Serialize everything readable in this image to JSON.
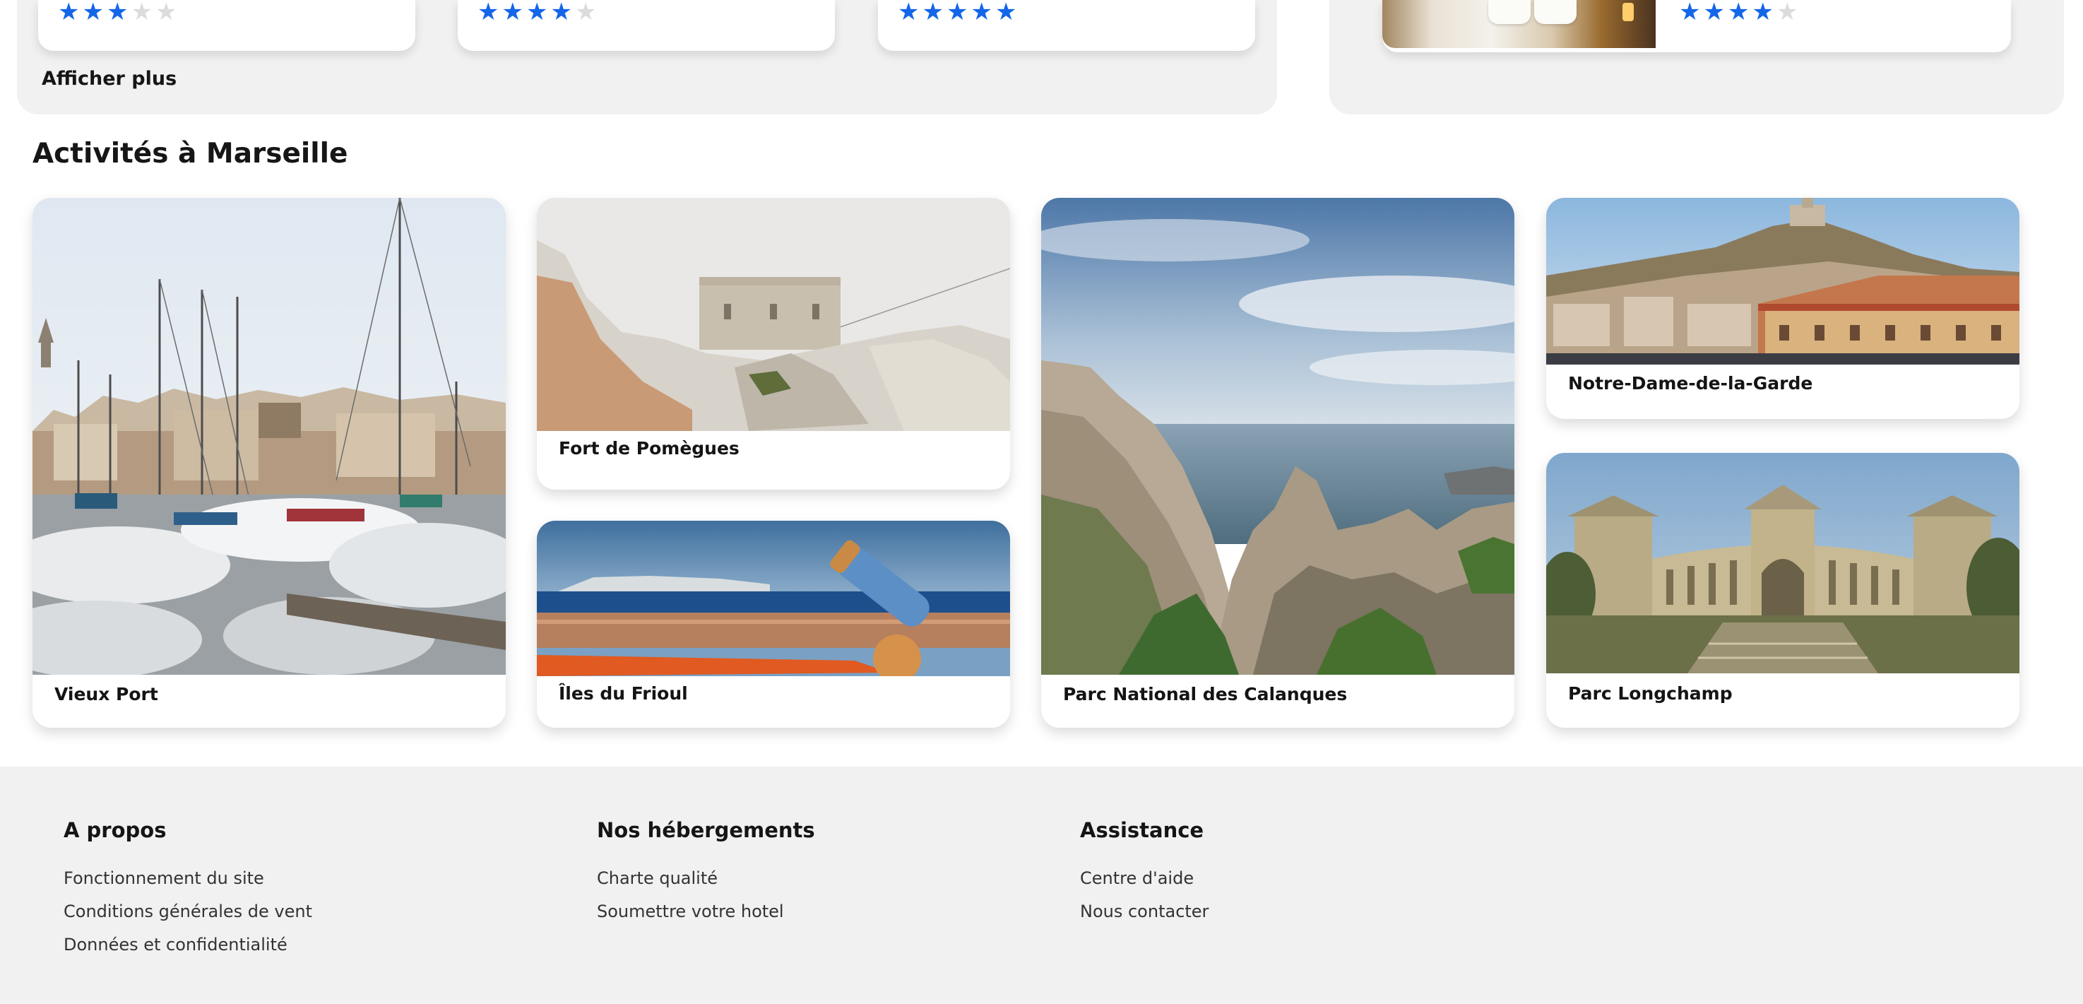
{
  "top": {
    "show_more_label": "Afficher plus",
    "rating_cards": [
      {
        "rating": 3,
        "max": 5
      },
      {
        "rating": 4,
        "max": 5
      },
      {
        "rating": 5,
        "max": 5
      }
    ],
    "hotel_card": {
      "rating": 4,
      "max": 5
    }
  },
  "activities": {
    "title": "Activités à Marseille",
    "items": [
      {
        "name": "Vieux Port"
      },
      {
        "name": "Fort de Pomègues"
      },
      {
        "name": "Îles du Frioul"
      },
      {
        "name": "Parc National des Calanques"
      },
      {
        "name": "Notre-Dame-de-la-Garde"
      },
      {
        "name": "Parc Longchamp"
      }
    ]
  },
  "footer": {
    "about": {
      "title": "A propos",
      "links": [
        "Fonctionnement du site",
        "Conditions générales de vent",
        "Données et confidentialité"
      ]
    },
    "accommodations": {
      "title": "Nos hébergements",
      "links": [
        "Charte qualité",
        "Soumettre votre hotel"
      ]
    },
    "assistance": {
      "title": "Assistance",
      "links": [
        "Centre d'aide",
        "Nous contacter"
      ]
    }
  },
  "colors": {
    "star_active": "#1366e8",
    "star_inactive": "#dcdcdc",
    "panel_background": "#f1f1f1"
  }
}
